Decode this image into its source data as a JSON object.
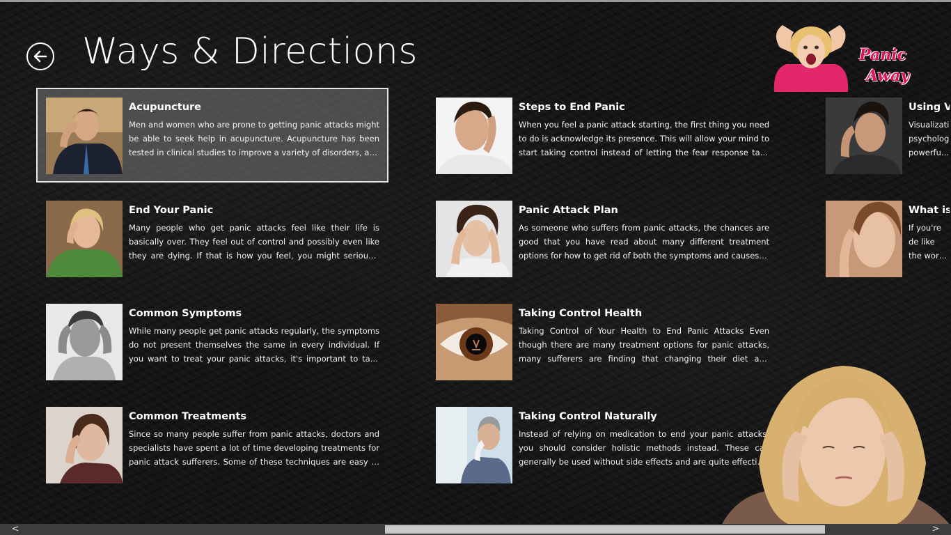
{
  "header": {
    "title": "Ways & Directions",
    "back_icon": "back-arrow-icon"
  },
  "logo": {
    "line1": "Panic",
    "line2": "Away"
  },
  "articles": [
    {
      "title": "Acupuncture",
      "body": "Men and women who are prone to getting panic attacks might be able to seek help in acupuncture. Acupuncture has been tested in clinical studies to improve a variety of disorders, and even..."
    },
    {
      "title": "End Your Panic",
      "body": "Many people who get panic attacks feel like their life is basically over. They feel out of control and possibly even like they are dying. If that is how you feel, you might seriously doubt there is any way..."
    },
    {
      "title": "Common Symptoms",
      "body": "While many people get panic attacks regularly, the symptoms do not present themselves the same in every individual. If you want to treat your panic attacks, it's important to take stock of your own..."
    },
    {
      "title": "Common Treatments",
      "body": "Since so many people suffer from panic attacks, doctors and specialists have spent a lot of time developing treatments for panic attack sufferers. Some of these techniques are easy to put into..."
    },
    {
      "title": "Steps to End Panic",
      "body": "When you feel a panic attack starting, the first thing you need to do is acknowledge its presence. This will allow your mind to start taking control instead of letting the fear response take over..."
    },
    {
      "title": "Panic Attack Plan",
      "body": "As someone who suffers from panic attacks, the chances are good that you have read about many different treatment options for how to get rid of both the symptoms and causes of panic attacks. It..."
    },
    {
      "title": "Taking Control Health",
      "body": "Taking Control of Your Health to End Panic Attacks Even though there are many treatment options for panic attacks, many sufferers are finding that changing their diet and becoming healthier is the..."
    },
    {
      "title": "Taking Control Naturally",
      "body": "Instead of relying on medication to end your panic attacks, you should consider holistic methods instead. These can generally be used without side effects and are quite effective. Instead of..."
    },
    {
      "title": "Using Vis",
      "body": "Visualization psychologic powerful th"
    },
    {
      "title": "What is a",
      "body": "If you're de like the wor experience"
    }
  ],
  "scrollbar": {
    "left_arrow": "<",
    "right_arrow": ">"
  }
}
